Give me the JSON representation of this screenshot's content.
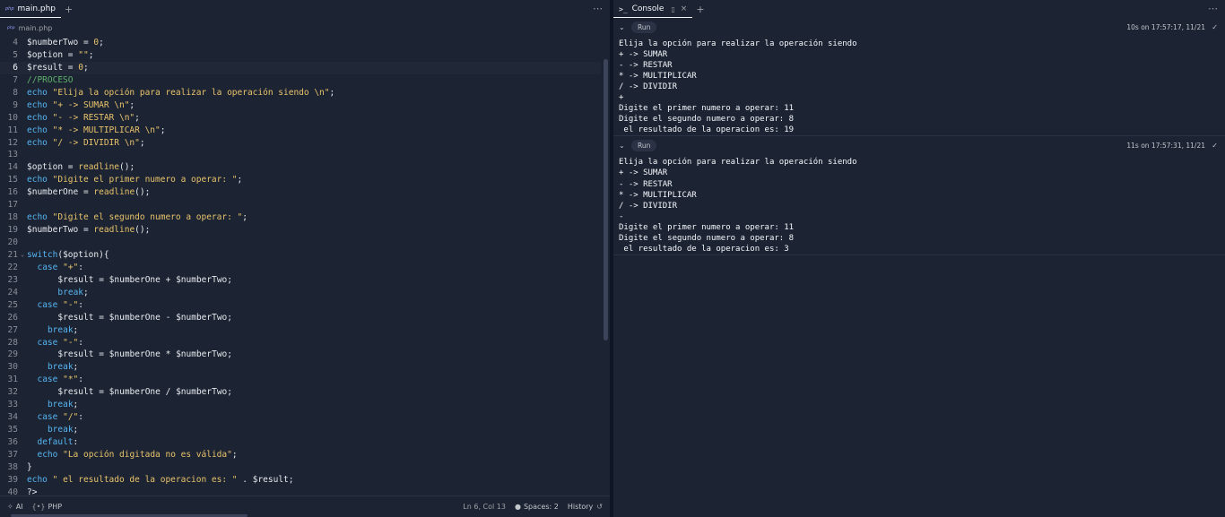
{
  "colors": {
    "background": "#1c2333",
    "keyword": "#56b6f2",
    "string": "#e9c46a",
    "number": "#e9c46a",
    "comment": "#5fb36b",
    "plain": "#e7ebee"
  },
  "editor": {
    "tab_label": "main.php",
    "tab_badge": "php",
    "breadcrumb": "main.php",
    "lines": [
      {
        "n": "4",
        "text": "$numberTwo = 0;"
      },
      {
        "n": "5",
        "text": "$option = \"\";"
      },
      {
        "n": "6",
        "text": "$result = 0;",
        "active": true
      },
      {
        "n": "7",
        "text": "//PROCESO"
      },
      {
        "n": "8",
        "text": "echo \"Elija la opción para realizar la operación siendo \\n\";"
      },
      {
        "n": "9",
        "text": "echo \"+ -> SUMAR \\n\";"
      },
      {
        "n": "10",
        "text": "echo \"- -> RESTAR \\n\";"
      },
      {
        "n": "11",
        "text": "echo \"* -> MULTIPLICAR \\n\";"
      },
      {
        "n": "12",
        "text": "echo \"/ -> DIVIDIR \\n\";"
      },
      {
        "n": "13",
        "text": ""
      },
      {
        "n": "14",
        "text": "$option = readline();"
      },
      {
        "n": "15",
        "text": "echo \"Digite el primer numero a operar: \";"
      },
      {
        "n": "16",
        "text": "$numberOne = readline();"
      },
      {
        "n": "17",
        "text": ""
      },
      {
        "n": "18",
        "text": "echo \"Digite el segundo numero a operar: \";"
      },
      {
        "n": "19",
        "text": "$numberTwo = readline();"
      },
      {
        "n": "20",
        "text": ""
      },
      {
        "n": "21",
        "text": "switch($option){",
        "fold": true
      },
      {
        "n": "22",
        "text": "  case \"+\":"
      },
      {
        "n": "23",
        "text": "      $result = $numberOne + $numberTwo;"
      },
      {
        "n": "24",
        "text": "      break;"
      },
      {
        "n": "25",
        "text": "  case \"-\":"
      },
      {
        "n": "26",
        "text": "      $result = $numberOne - $numberTwo;"
      },
      {
        "n": "27",
        "text": "    break;"
      },
      {
        "n": "28",
        "text": "  case \"-\":"
      },
      {
        "n": "29",
        "text": "      $result = $numberOne * $numberTwo;"
      },
      {
        "n": "30",
        "text": "    break;"
      },
      {
        "n": "31",
        "text": "  case \"*\":"
      },
      {
        "n": "32",
        "text": "      $result = $numberOne / $numberTwo;"
      },
      {
        "n": "33",
        "text": "    break;"
      },
      {
        "n": "34",
        "text": "  case \"/\":"
      },
      {
        "n": "35",
        "text": "    break;"
      },
      {
        "n": "36",
        "text": "  default:"
      },
      {
        "n": "37",
        "text": "  echo \"La opción digitada no es válida\";"
      },
      {
        "n": "38",
        "text": "}"
      },
      {
        "n": "39",
        "text": "echo \" el resultado de la operacion es: \" . $result;"
      },
      {
        "n": "40",
        "text": "?>"
      }
    ]
  },
  "statusbar": {
    "ai_label": "AI",
    "language_icon": "{•}",
    "language_label": "PHP",
    "cursor_position": "Ln 6, Col 13",
    "spaces_label": "Spaces: 2",
    "history_label": "History"
  },
  "console": {
    "tab_label": "Console",
    "runs": [
      {
        "run_label": "Run",
        "time": "10s on 17:57:17, 11/21",
        "output": [
          "Elija la opción para realizar la operación siendo",
          "+ -> SUMAR",
          "- -> RESTAR",
          "* -> MULTIPLICAR",
          "/ -> DIVIDIR",
          "+",
          "Digite el primer numero a operar: 11",
          "Digite el segundo numero a operar: 8",
          " el resultado de la operacion es: 19"
        ]
      },
      {
        "run_label": "Run",
        "time": "11s on 17:57:31, 11/21",
        "output": [
          "Elija la opción para realizar la operación siendo",
          "+ -> SUMAR",
          "- -> RESTAR",
          "* -> MULTIPLICAR",
          "/ -> DIVIDIR",
          "-",
          "Digite el primer numero a operar: 11",
          "Digite el segundo numero a operar: 8",
          " el resultado de la operacion es: 3"
        ]
      }
    ]
  }
}
